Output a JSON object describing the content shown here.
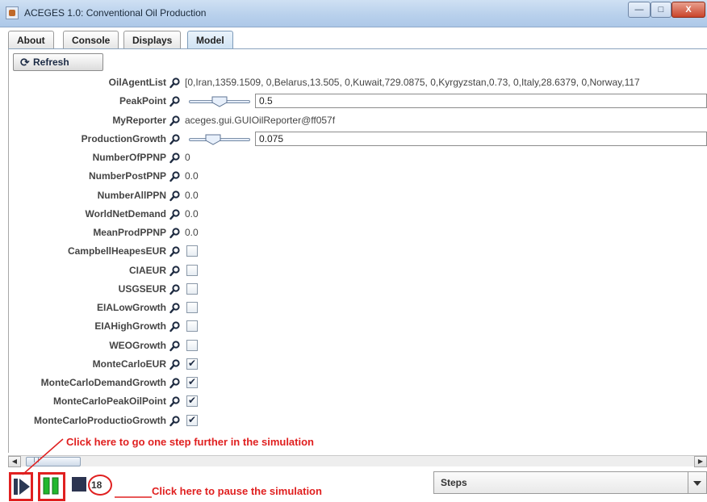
{
  "window": {
    "title": "ACEGES 1.0: Conventional Oil Production"
  },
  "tabs": [
    {
      "label": "About"
    },
    {
      "label": "Console"
    },
    {
      "label": "Displays"
    },
    {
      "label": "Model",
      "active": true
    }
  ],
  "toolbar": {
    "refresh_label": "Refresh"
  },
  "properties": [
    {
      "name": "OilAgentList",
      "type": "text",
      "value": "[0,Iran,1359.1509, 0,Belarus,13.505, 0,Kuwait,729.0875, 0,Kyrgyzstan,0.73, 0,Italy,28.6379, 0,Norway,117"
    },
    {
      "name": "PeakPoint",
      "type": "slider",
      "value": "0.5",
      "slider_fraction": 0.5
    },
    {
      "name": "MyReporter",
      "type": "text",
      "value": "aceges.gui.GUIOilReporter@ff057f"
    },
    {
      "name": "ProductionGrowth",
      "type": "slider",
      "value": "0.075",
      "slider_fraction": 0.36
    },
    {
      "name": "NumberOfPPNP",
      "type": "text",
      "value": "0"
    },
    {
      "name": "NumberPostPNP",
      "type": "text",
      "value": "0.0"
    },
    {
      "name": "NumberAllPPN",
      "type": "text",
      "value": "0.0"
    },
    {
      "name": "WorldNetDemand",
      "type": "text",
      "value": "0.0"
    },
    {
      "name": "MeanProdPPNP",
      "type": "text",
      "value": "0.0"
    },
    {
      "name": "CampbellHeapesEUR",
      "type": "checkbox",
      "checked": false
    },
    {
      "name": "CIAEUR",
      "type": "checkbox",
      "checked": false
    },
    {
      "name": "USGSEUR",
      "type": "checkbox",
      "checked": false
    },
    {
      "name": "EIALowGrowth",
      "type": "checkbox",
      "checked": false
    },
    {
      "name": "EIAHighGrowth",
      "type": "checkbox",
      "checked": false
    },
    {
      "name": "WEOGrowth",
      "type": "checkbox",
      "checked": false
    },
    {
      "name": "MonteCarloEUR",
      "type": "checkbox",
      "checked": true
    },
    {
      "name": "MonteCarloDemandGrowth",
      "type": "checkbox",
      "checked": true
    },
    {
      "name": "MonteCarloPeakOilPoint",
      "type": "checkbox",
      "checked": true
    },
    {
      "name": "MonteCarloProductioGrowth",
      "type": "checkbox",
      "checked": true
    }
  ],
  "controls": {
    "step_count": "18",
    "steps_label": "Steps"
  },
  "annotations": {
    "step_hint": "Click here to go one step further in the simulation",
    "pause_hint": "Click here to pause the simulation"
  },
  "colors": {
    "annotation_red": "#e02020",
    "pause_green": "#22b82e",
    "label_gray": "#444444"
  },
  "icons": {
    "property_inspect": "magnifier-icon",
    "check": "✔"
  }
}
